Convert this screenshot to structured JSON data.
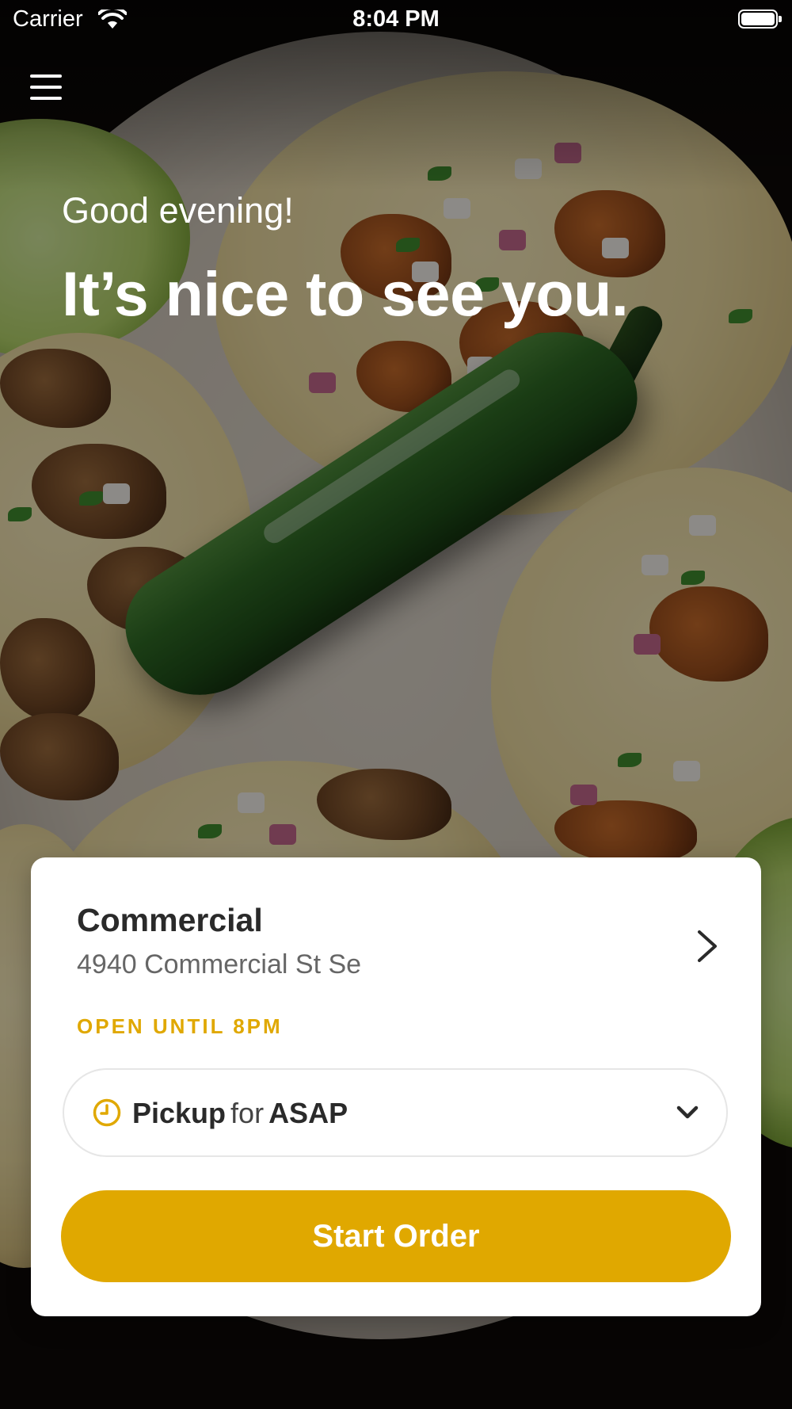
{
  "status_bar": {
    "carrier": "Carrier",
    "time": "8:04 PM"
  },
  "header": {
    "greeting": "Good evening!",
    "headline": "It’s nice to see you."
  },
  "store": {
    "name": "Commercial",
    "address": "4940 Commercial St Se",
    "hours": "OPEN UNTIL 8PM"
  },
  "order_mode": {
    "method": "Pickup",
    "connector": "for",
    "time": "ASAP"
  },
  "start_button": {
    "label": "Start Order"
  },
  "colors": {
    "accent": "#e0a800",
    "card": "#ffffff",
    "text_primary": "#2a2a2a",
    "text_secondary": "#666666"
  },
  "icons": [
    "menu-icon",
    "wifi-icon",
    "battery-icon",
    "chevron-right-icon",
    "clock-icon",
    "chevron-down-icon"
  ]
}
